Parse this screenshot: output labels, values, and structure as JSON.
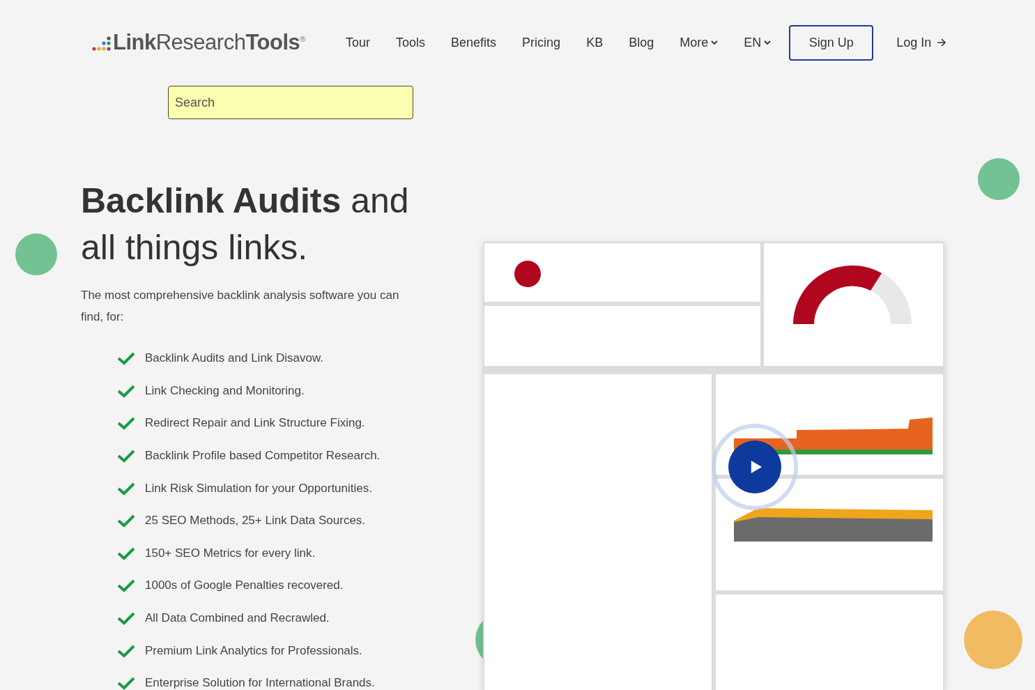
{
  "header": {
    "logo": "**Link**Research**Tools**$^{®}$",
    "nav": [
      {
        "label": "Tour",
        "dropdown": false
      },
      {
        "label": "Tools",
        "dropdown": false
      },
      {
        "label": "Benefits",
        "dropdown": false
      },
      {
        "label": "Pricing",
        "dropdown": false
      },
      {
        "label": "KB",
        "dropdown": false
      },
      {
        "label": "Blog",
        "dropdown": false
      },
      {
        "label": "More",
        "dropdown": true
      },
      {
        "label": "EN",
        "dropdown": true
      }
    ],
    "sign_up": "Sign Up",
    "log_in": "Log In"
  },
  "search": {
    "placeholder": "Search"
  },
  "hero": {
    "title": "**Backlink Audits** and all things links.",
    "intro": "The most comprehensive backlink analysis software you can find, for:",
    "features": [
      "Backlink Audits and Link Disavow.",
      "Link Checking and Monitoring.",
      "Redirect Repair and Link Structure Fixing.",
      "Backlink Profile based Competitor Research.",
      "Link Risk Simulation for your Opportunities.",
      "25 SEO Methods, 25+ Link Data Sources.",
      "150+ SEO Metrics for every link.",
      "1000s of Google Penalties recovered.",
      "All Data Combined and Recrawled.",
      "Premium Link Analytics for Professionals.",
      "Enterprise Solution for International Brands."
    ]
  }
}
